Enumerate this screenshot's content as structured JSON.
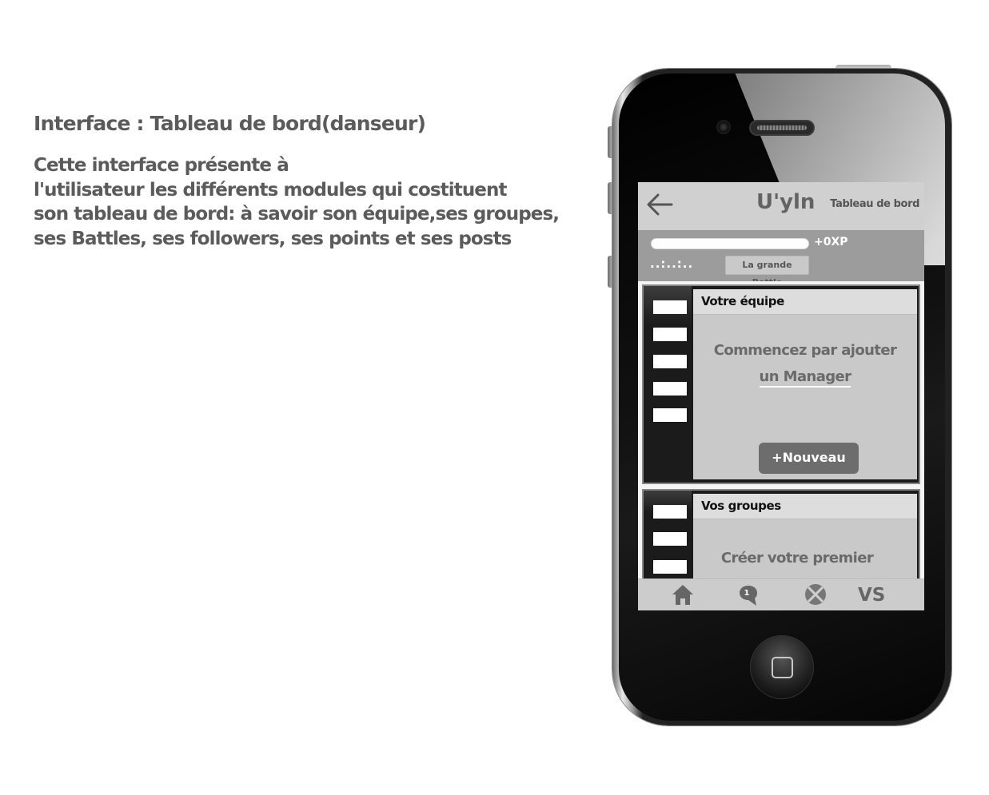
{
  "description": {
    "title": "Interface : Tableau de bord(danseur)",
    "lines": [
      "Cette interface présente à",
      "l'utilisateur les différents modules qui costituent",
      "son tableau de bord: à savoir son équipe,ses groupes,",
      "ses Battles, ses followers, ses points et ses posts"
    ]
  },
  "app": {
    "back_icon": "arrow-left-icon",
    "brand": "U'yln",
    "screen_title": "Tableau de bord"
  },
  "xp": {
    "progress": 0,
    "label": "+0XP",
    "dots": "..:..:..",
    "battle_chip": "La grande Battle"
  },
  "cards": {
    "team": {
      "title": "Votre équipe",
      "message_line1": "Commencez par ajouter",
      "message_line2": "un Manager",
      "button": "+Nouveau"
    },
    "groups": {
      "title": "Vos groupes",
      "message_line1": "Créer votre premier"
    }
  },
  "tabbar": {
    "home_icon": "home-icon",
    "chat_icon": "chat-bubble-icon",
    "chat_badge": "1",
    "battle_icon": "crossed-circle-icon",
    "vs_label": "VS"
  },
  "colors": {
    "screen_bg": "#d5d5d5",
    "header_bg": "#d0d0d0",
    "xp_bar_bg": "#9c9c9c",
    "card_rail": "#1b1b1b",
    "button_bg": "#6d6d6d"
  }
}
